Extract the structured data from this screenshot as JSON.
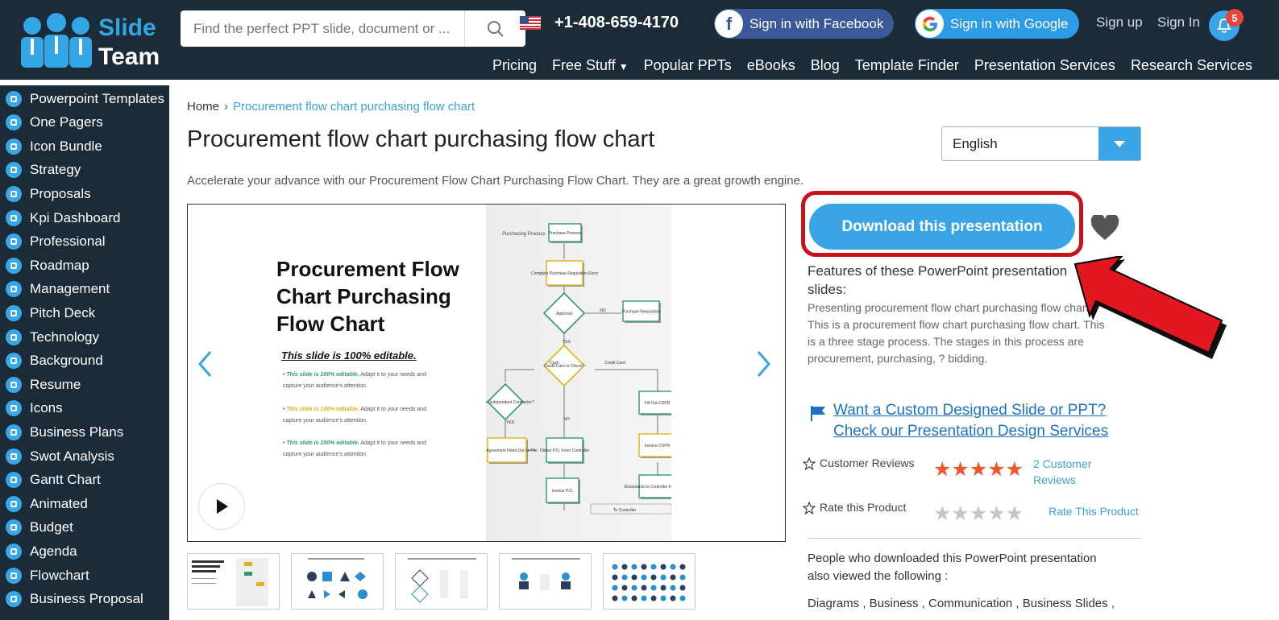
{
  "header": {
    "logo_line1": "Slide",
    "logo_line2": "Team",
    "search_placeholder": "Find the perfect PPT slide, document or ...",
    "phone": "+1-408-659-4170",
    "facebook_label": "Sign in with Facebook",
    "google_label": "Sign in with Google",
    "signup": "Sign up",
    "signin": "Sign In",
    "notification_count": "5",
    "nav": [
      "Pricing",
      "Free Stuff",
      "Popular PPTs",
      "eBooks",
      "Blog",
      "Template Finder",
      "Presentation Services",
      "Research Services"
    ]
  },
  "sidebar": {
    "items": [
      {
        "label": "Powerpoint Templates",
        "icon": "template-icon"
      },
      {
        "label": "One Pagers",
        "icon": "one-pager-icon"
      },
      {
        "label": "Icon Bundle",
        "icon": "icon-bundle-icon"
      },
      {
        "label": "Strategy",
        "icon": "strategy-icon"
      },
      {
        "label": "Proposals",
        "icon": "proposals-icon"
      },
      {
        "label": "Kpi Dashboard",
        "icon": "dashboard-icon"
      },
      {
        "label": "Professional",
        "icon": "professional-icon"
      },
      {
        "label": "Roadmap",
        "icon": "roadmap-icon"
      },
      {
        "label": "Management",
        "icon": "management-icon"
      },
      {
        "label": "Pitch Deck",
        "icon": "pitch-deck-icon"
      },
      {
        "label": "Technology",
        "icon": "technology-icon"
      },
      {
        "label": "Background",
        "icon": "background-icon"
      },
      {
        "label": "Resume",
        "icon": "resume-icon"
      },
      {
        "label": "Icons",
        "icon": "icons-icon"
      },
      {
        "label": "Business Plans",
        "icon": "business-plans-icon"
      },
      {
        "label": "Swot Analysis",
        "icon": "swot-icon"
      },
      {
        "label": "Gantt Chart",
        "icon": "gantt-icon"
      },
      {
        "label": "Animated",
        "icon": "animated-icon"
      },
      {
        "label": "Budget",
        "icon": "budget-icon"
      },
      {
        "label": "Agenda",
        "icon": "agenda-icon"
      },
      {
        "label": "Flowchart",
        "icon": "flowchart-icon"
      },
      {
        "label": "Business Proposal",
        "icon": "business-proposal-icon"
      }
    ]
  },
  "main": {
    "breadcrumb_home": "Home",
    "breadcrumb_current": "Procurement flow chart purchasing flow chart",
    "title": "Procurement flow chart purchasing flow chart",
    "language": "English",
    "description": "Accelerate your advance with our Procurement Flow Chart Purchasing Flow Chart. They are a great growth engine.",
    "slide": {
      "title": "Procurement Flow Chart Purchasing Flow Chart",
      "editable": "This slide is 100% editable.",
      "bullets": [
        {
          "bold": "This slide is 100% editable.",
          "text": "Adapt it to your needs and capture your audience's attention.",
          "color": "#2e9a6e"
        },
        {
          "bold": "This slide is 100% editable.",
          "text": "Adapt it to your needs and capture your audience's attention.",
          "color": "#e3b11c"
        },
        {
          "bold": "This slide is 100% editable.",
          "text": "Adapt it to your needs and capture your audience's attention.",
          "color": "#2e9a6e"
        }
      ],
      "flow_heading": "Purchasing Process",
      "flow_nodes": [
        "Purchase Process",
        "Complete Purchase Requisition Form",
        "Approval",
        "Purchase Requisition",
        "Credit Card or Check?",
        "Is it an Independent Contractor?",
        "Fill Out COPR",
        "1099 Agreement Filled Out on File",
        "Obtain P.O. From Controller",
        "Invoice COPR",
        "Invoice P.O.",
        "Documents to Controller for Approval",
        "To Controller"
      ],
      "flow_edge_labels": [
        "NO",
        "YES",
        "Cash",
        "Credit Card",
        "YES",
        "NO"
      ]
    }
  },
  "aside": {
    "download": "Download this presentation",
    "features_title": "Features of these PowerPoint presentation slides:",
    "features_text": "Presenting procurement flow chart purchasing flow chart. This is a procurement flow chart purchasing flow chart. This is a three stage process. The stages in this process are procurement, purchasing, ? bidding.",
    "custom_link": "Want a Custom Designed Slide or PPT? Check our Presentation Design Services",
    "customer_reviews": "Customer Reviews",
    "rating_stars": "★★★★★",
    "review_count": "2  Customer Reviews",
    "rate_product": "Rate this Product",
    "rate_stars": "★★★★★",
    "rate_link": "Rate This Product",
    "also_title": "People who downloaded this PowerPoint presentation also viewed the following :",
    "also_list": "Diagrams , Business , Communication , Business Slides ,"
  },
  "colors": {
    "header_bg": "#1c2b38",
    "accent": "#3aa5e6",
    "highlight_red": "#c8121b",
    "star_orange": "#f0562c"
  }
}
